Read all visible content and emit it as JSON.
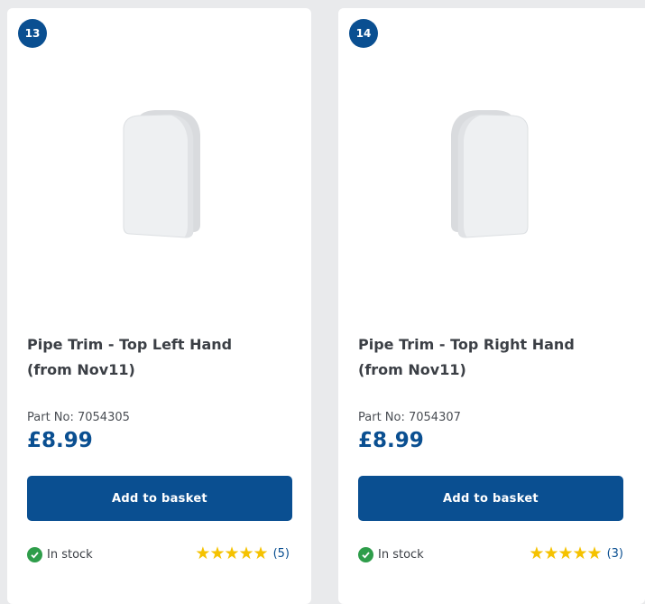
{
  "products": [
    {
      "index": "13",
      "title": "Pipe Trim - Top Left Hand (from Nov11)",
      "part_no": "Part No: 7054305",
      "price": "£8.99",
      "button_label": "Add to basket",
      "stock": "In stock",
      "stars": "★★★★★",
      "rating_count": "(5)",
      "image_icon": "pipe-trim-left-image"
    },
    {
      "index": "14",
      "title": "Pipe Trim - Top Right Hand (from Nov11)",
      "part_no": "Part No: 7054307",
      "price": "£8.99",
      "button_label": "Add to basket",
      "stock": "In stock",
      "stars": "★★★★★",
      "rating_count": "(3)",
      "image_icon": "pipe-trim-right-image"
    }
  ],
  "colors": {
    "brand": "#0a4f91",
    "in_stock": "#2e9d4a",
    "star": "#f5c200"
  }
}
